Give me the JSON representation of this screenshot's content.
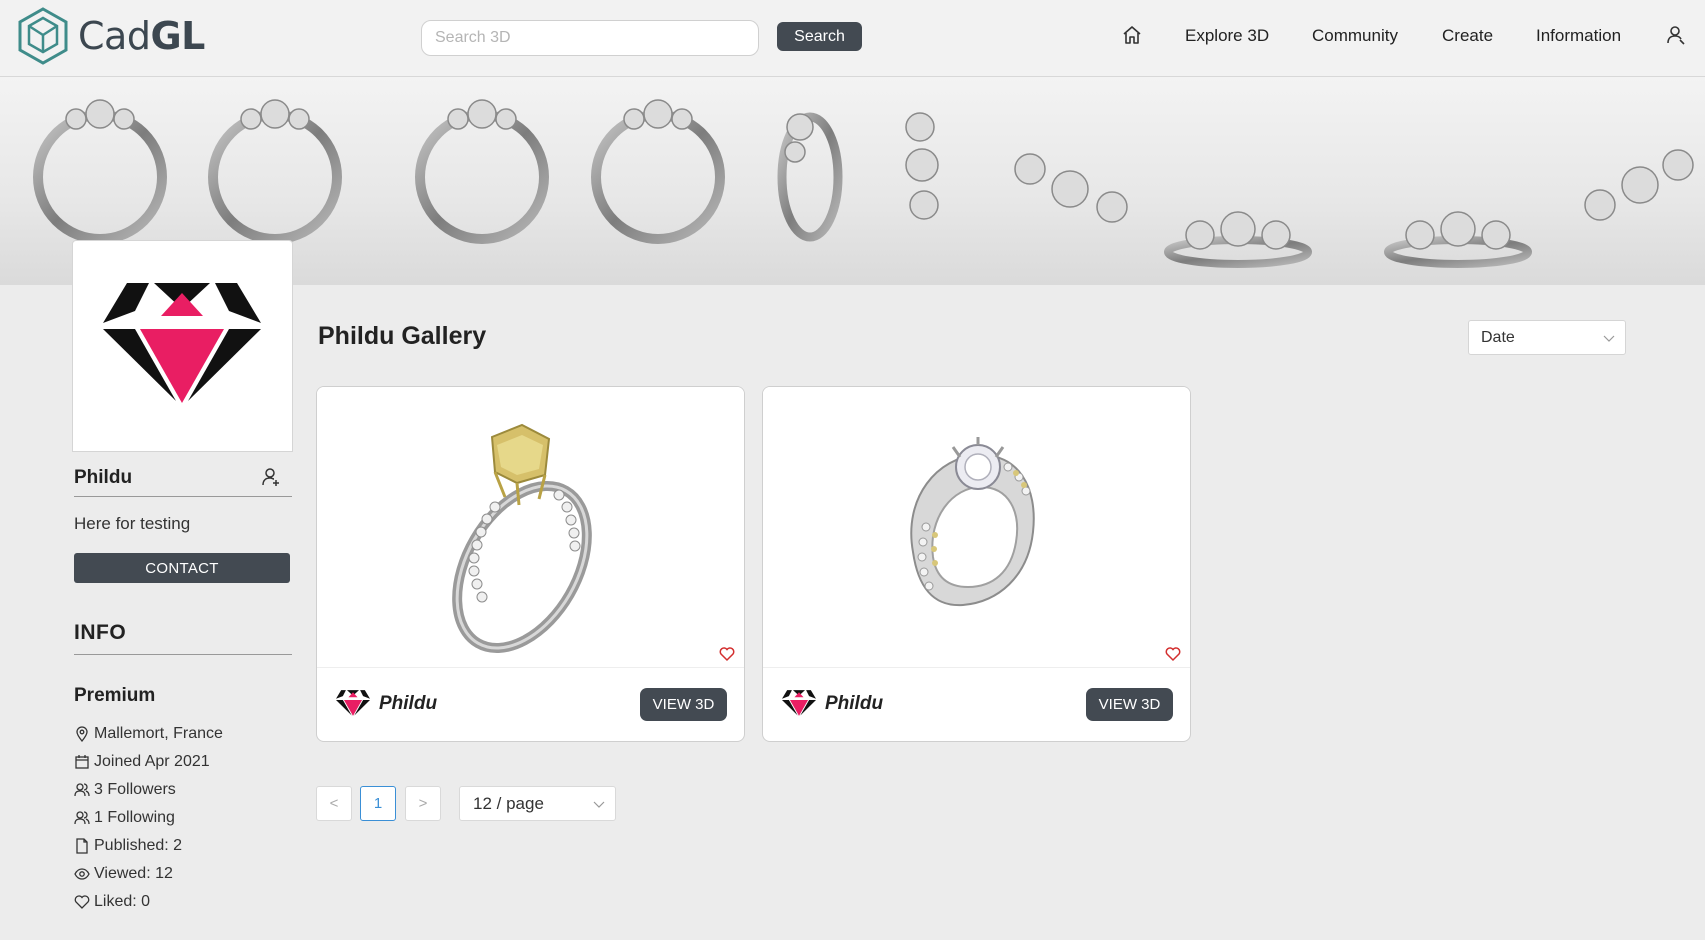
{
  "brand": {
    "name_light": "Cad",
    "name_bold": "GL"
  },
  "search": {
    "placeholder": "Search 3D",
    "button_label": "Search"
  },
  "nav": {
    "items": [
      {
        "icon": "home-icon"
      },
      {
        "label": "Explore 3D"
      },
      {
        "label": "Community"
      },
      {
        "label": "Create"
      },
      {
        "label": "Information"
      },
      {
        "icon": "user-account-icon"
      }
    ]
  },
  "profile": {
    "username": "Phildu",
    "bio": "Here for testing",
    "contact_label": "CONTACT",
    "info_title": "INFO",
    "tier": "Premium",
    "details": [
      {
        "icon": "location-pin-icon",
        "text": "Mallemort, France"
      },
      {
        "icon": "calendar-icon",
        "text": "Joined Apr 2021"
      },
      {
        "icon": "followers-icon",
        "text": "3 Followers"
      },
      {
        "icon": "following-icon",
        "text": "1 Following"
      },
      {
        "icon": "document-icon",
        "text": "Published: 2"
      },
      {
        "icon": "eye-icon",
        "text": "Viewed: 12"
      },
      {
        "icon": "heart-icon",
        "text": "Liked: 0"
      }
    ]
  },
  "gallery": {
    "title": "Phildu Gallery",
    "sort_value": "Date",
    "cards": [
      {
        "author": "Phildu",
        "button_label": "VIEW 3D",
        "stone_color": "#d6c06a"
      },
      {
        "author": "Phildu",
        "button_label": "VIEW 3D",
        "stone_color": "#e8e8ee"
      }
    ]
  },
  "pagination": {
    "prev": "<",
    "current_page": "1",
    "next": ">",
    "per_page": "12 / page"
  },
  "colors": {
    "accent_pink": "#e91e63",
    "button_dark": "#434a52",
    "page_active": "#3a8fd6"
  }
}
